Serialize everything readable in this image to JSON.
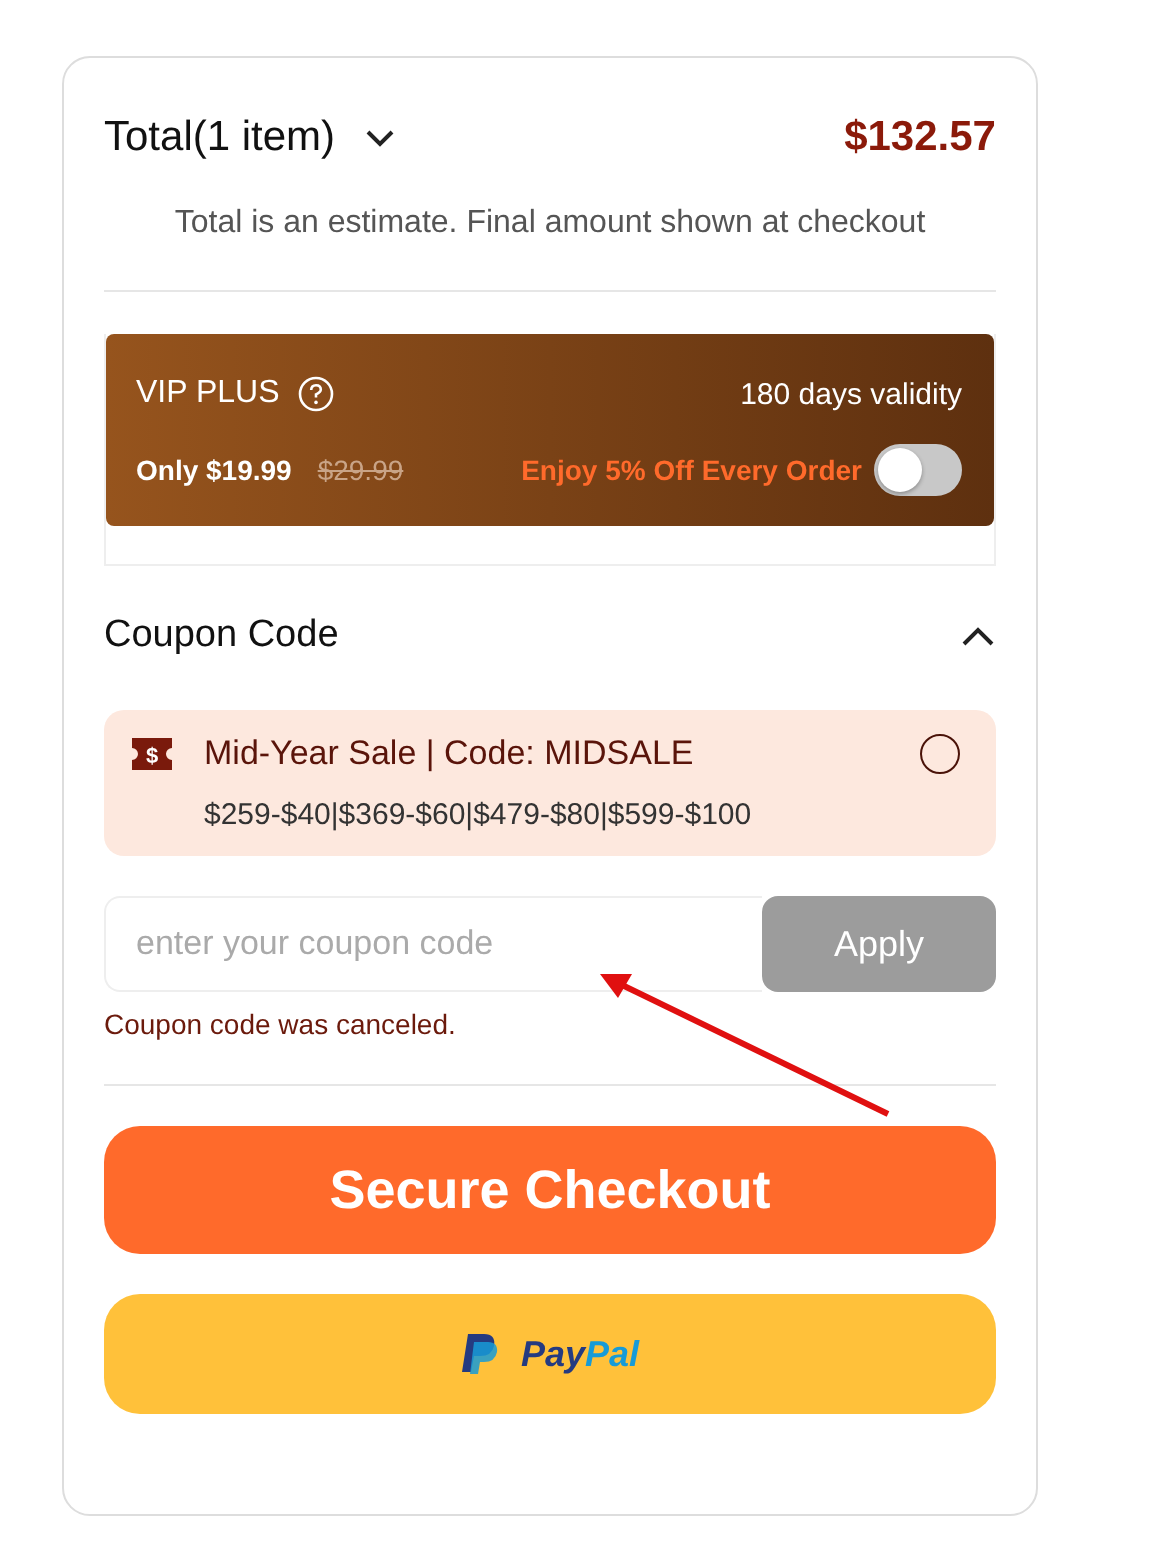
{
  "summary": {
    "title": "Total(1 item)",
    "expanded": false,
    "amount": "$132.57",
    "note": "Total is an estimate. Final amount shown at checkout"
  },
  "vip": {
    "title": "VIP PLUS",
    "validity": "180 days validity",
    "price": "Only $19.99",
    "old_price": "$29.99",
    "offer": "Enjoy 5% Off Every Order",
    "on": false
  },
  "coupon_section": {
    "title": "Coupon Code",
    "expanded": true
  },
  "coupons": [
    {
      "icon_text": "$",
      "title": "Mid-Year Sale | Code: MIDSALE",
      "tiers": "$259-$40|$369-$60|$479-$80|$599-$100",
      "selected": false
    }
  ],
  "coupon_input": {
    "placeholder": "enter your coupon code",
    "button": "Apply",
    "disabled": true,
    "message": "Coupon code was canceled."
  },
  "checkout_button": "Secure Checkout",
  "paypal_button": {
    "parts": [
      "Pay",
      "Pal"
    ]
  }
}
